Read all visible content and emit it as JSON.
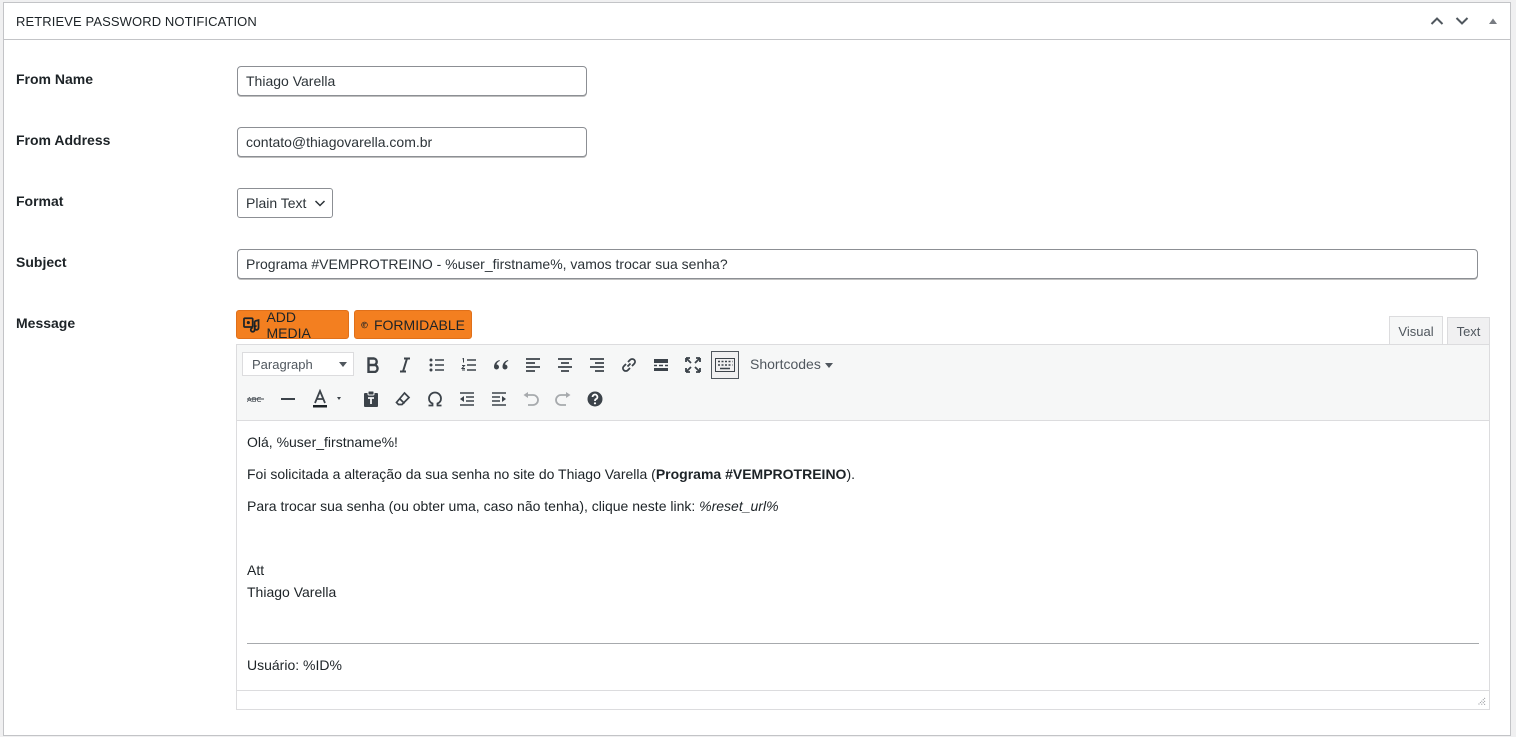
{
  "panel": {
    "title": "RETRIEVE PASSWORD NOTIFICATION"
  },
  "fields": {
    "from_name": {
      "label": "From Name",
      "value": "Thiago Varella"
    },
    "from_address": {
      "label": "From Address",
      "value": "contato@thiagovarella.com.br"
    },
    "format": {
      "label": "Format",
      "value": "Plain Text"
    },
    "subject": {
      "label": "Subject",
      "value": "Programa #VEMPROTREINO - %user_firstname%, vamos trocar sua senha?"
    },
    "message": {
      "label": "Message"
    }
  },
  "editor": {
    "add_media_label": "ADD MEDIA",
    "formidable_label": "FORMIDABLE",
    "tabs": {
      "visual": "Visual",
      "text": "Text"
    },
    "paragraph_select": "Paragraph",
    "shortcodes_label": "Shortcodes",
    "content": {
      "greeting": "Olá, %user_firstname%!",
      "line2_prefix": "Foi solicitada a alteração da sua senha no site do Thiago Varella (",
      "line2_bold": "Programa #VEMPROTREINO",
      "line2_suffix": ").",
      "line3_prefix": "Para trocar sua senha (ou obter uma, caso não tenha), clique neste link: ",
      "line3_italic": "%reset_url%",
      "sign_att": "Att",
      "sign_name": "Thiago Varella",
      "footer": "Usuário: %ID%"
    }
  },
  "colors": {
    "accent_orange": "#f37f20",
    "border": "#c3c4c7",
    "text": "#1d2327",
    "toolbar_bg": "#f6f7f7"
  }
}
